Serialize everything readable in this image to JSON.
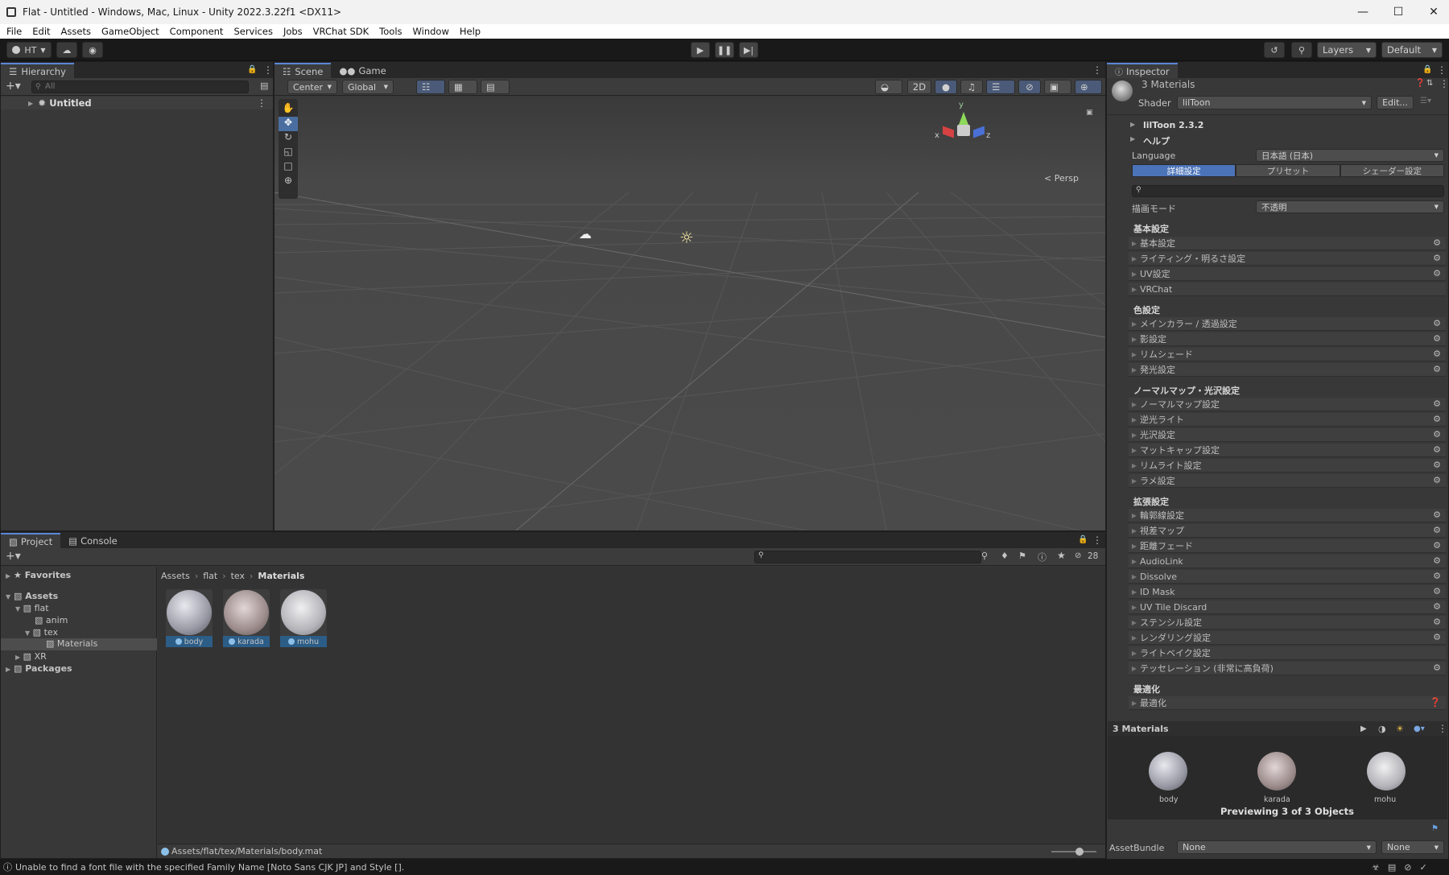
{
  "window": {
    "title": "Flat - Untitled - Windows, Mac, Linux - Unity 2022.3.22f1 <DX11>"
  },
  "menu": [
    "File",
    "Edit",
    "Assets",
    "GameObject",
    "Component",
    "Services",
    "Jobs",
    "VRChat SDK",
    "Tools",
    "Window",
    "Help"
  ],
  "toolbar": {
    "account": "HT",
    "layers": "Layers",
    "layout": "Default"
  },
  "hierarchy": {
    "tab": "Hierarchy",
    "search_placeholder": "All",
    "scene": "Untitled"
  },
  "scene_view": {
    "tab_scene": "Scene",
    "tab_game": "Game",
    "pivot": "Center",
    "space": "Global",
    "mode_2d": "2D",
    "persp": "< Persp",
    "gizmo_y": "y",
    "gizmo_x": "x",
    "gizmo_z": "z"
  },
  "project": {
    "tab_project": "Project",
    "tab_console": "Console",
    "favorites": "Favorites",
    "tree": {
      "assets": "Assets",
      "flat": "flat",
      "anim": "anim",
      "tex": "tex",
      "materials": "Materials",
      "xr": "XR",
      "packages": "Packages"
    },
    "breadcrumb": [
      "Assets",
      "flat",
      "tex",
      "Materials"
    ],
    "count": "28",
    "items": [
      "body",
      "karada",
      "mohu"
    ],
    "path": "Assets/flat/tex/Materials/body.mat"
  },
  "inspector": {
    "tab": "Inspector",
    "title": "3 Materials",
    "shader_label": "Shader",
    "shader_value": "lilToon",
    "edit_button": "Edit...",
    "version": "lilToon 2.3.2",
    "help": "ヘルプ",
    "language_label": "Language",
    "language_value": "日本語 (日本)",
    "tabs": [
      "詳細設定",
      "プリセット",
      "シェーダー設定"
    ],
    "render_mode_label": "描画モード",
    "render_mode_value": "不透明",
    "sections": [
      {
        "header": "基本設定",
        "rows": [
          "基本設定",
          "ライティング・明るさ設定",
          "UV設定",
          "VRChat"
        ]
      },
      {
        "header": "色設定",
        "rows": [
          "メインカラー / 透過設定",
          "影設定",
          "リムシェード",
          "発光設定"
        ]
      },
      {
        "header": "ノーマルマップ・光沢設定",
        "rows": [
          "ノーマルマップ設定",
          "逆光ライト",
          "光沢設定",
          "マットキャップ設定",
          "リムライト設定",
          "ラメ設定"
        ]
      },
      {
        "header": "拡張設定",
        "rows": [
          "輪郭線設定",
          "視差マップ",
          "距離フェード",
          "AudioLink",
          "Dissolve",
          "ID Mask",
          "UV Tile Discard",
          "ステンシル設定",
          "レンダリング設定",
          "ライトベイク設定",
          "テッセレーション (非常に高負荷)"
        ]
      },
      {
        "header": "最適化",
        "rows": [
          "最適化"
        ]
      }
    ],
    "preview": {
      "title": "3 Materials",
      "items": [
        "body",
        "karada",
        "mohu"
      ],
      "caption": "Previewing 3 of 3 Objects"
    },
    "assetbundle_label": "AssetBundle",
    "assetbundle_value": "None",
    "assetbundle_variant": "None"
  },
  "status": {
    "message": "Unable to find a font file with the specified Family Name [Noto Sans CJK JP] and Style []."
  }
}
